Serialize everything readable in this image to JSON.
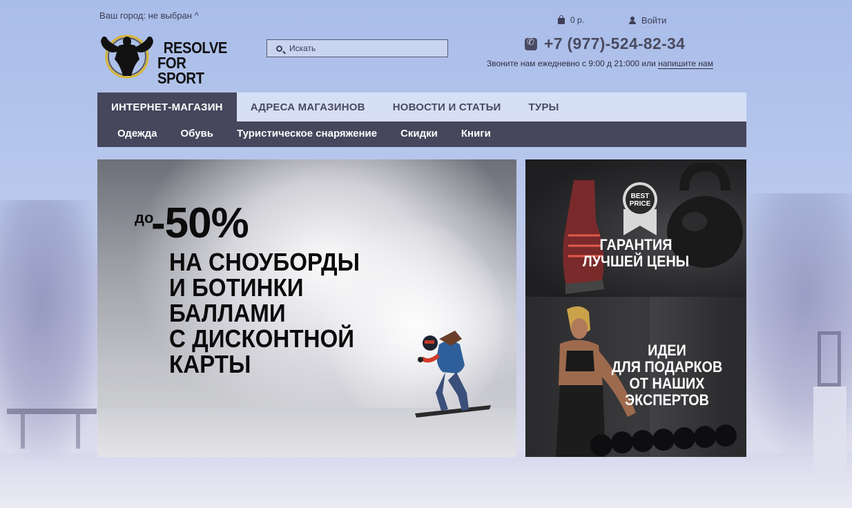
{
  "header": {
    "city_label": "Ваш город: не выбран ^",
    "cart_label": "0 р.",
    "login_label": "Войти",
    "search_placeholder": "Искать",
    "phone": "+7 (977)-524-82-34",
    "call_note_prefix": "Звоните нам ежедневно с 9:00 д 21:000  или",
    "call_note_link": "напишите нам"
  },
  "logo": {
    "line1": "RESOLVE",
    "line2": "FOR SPORT"
  },
  "main_nav": [
    {
      "label": "ИНТЕРНЕТ-МАГАЗИН",
      "active": true
    },
    {
      "label": "АДРЕСА МАГАЗИНОВ",
      "active": false
    },
    {
      "label": "НОВОСТИ И СТАТЬИ",
      "active": false
    },
    {
      "label": "ТУРЫ",
      "active": false
    }
  ],
  "sub_nav": [
    {
      "label": "Одежда"
    },
    {
      "label": "Обувь"
    },
    {
      "label": "Туристическое снаряжение"
    },
    {
      "label": "Скидки"
    },
    {
      "label": "Книги"
    }
  ],
  "banners": {
    "main": {
      "prefix": "до",
      "discount": "-50%",
      "lines": [
        "НА СНОУБОРДЫ",
        "И БОТИНКИ",
        "БАЛЛАМИ",
        "С ДИСКОНТНОЙ",
        "КАРТЫ"
      ]
    },
    "side1": {
      "badge_line1": "BEST",
      "badge_line2": "PRICE",
      "lines": [
        "ГАРАНТИЯ",
        "ЛУЧШЕЙ ЦЕНЫ"
      ]
    },
    "side2": {
      "lines": [
        "ИДЕИ",
        "ДЛЯ ПОДАРКОВ",
        "ОТ НАШИХ",
        "ЭКСПЕРТОВ"
      ]
    }
  },
  "icons": {
    "cart": "shopping-bag-icon",
    "login": "user-icon",
    "search": "search-icon",
    "phone": "phone-icon"
  },
  "colors": {
    "nav_dark": "#46465c",
    "nav_light": "#dce4f8",
    "text_dark": "#4a4a60"
  }
}
